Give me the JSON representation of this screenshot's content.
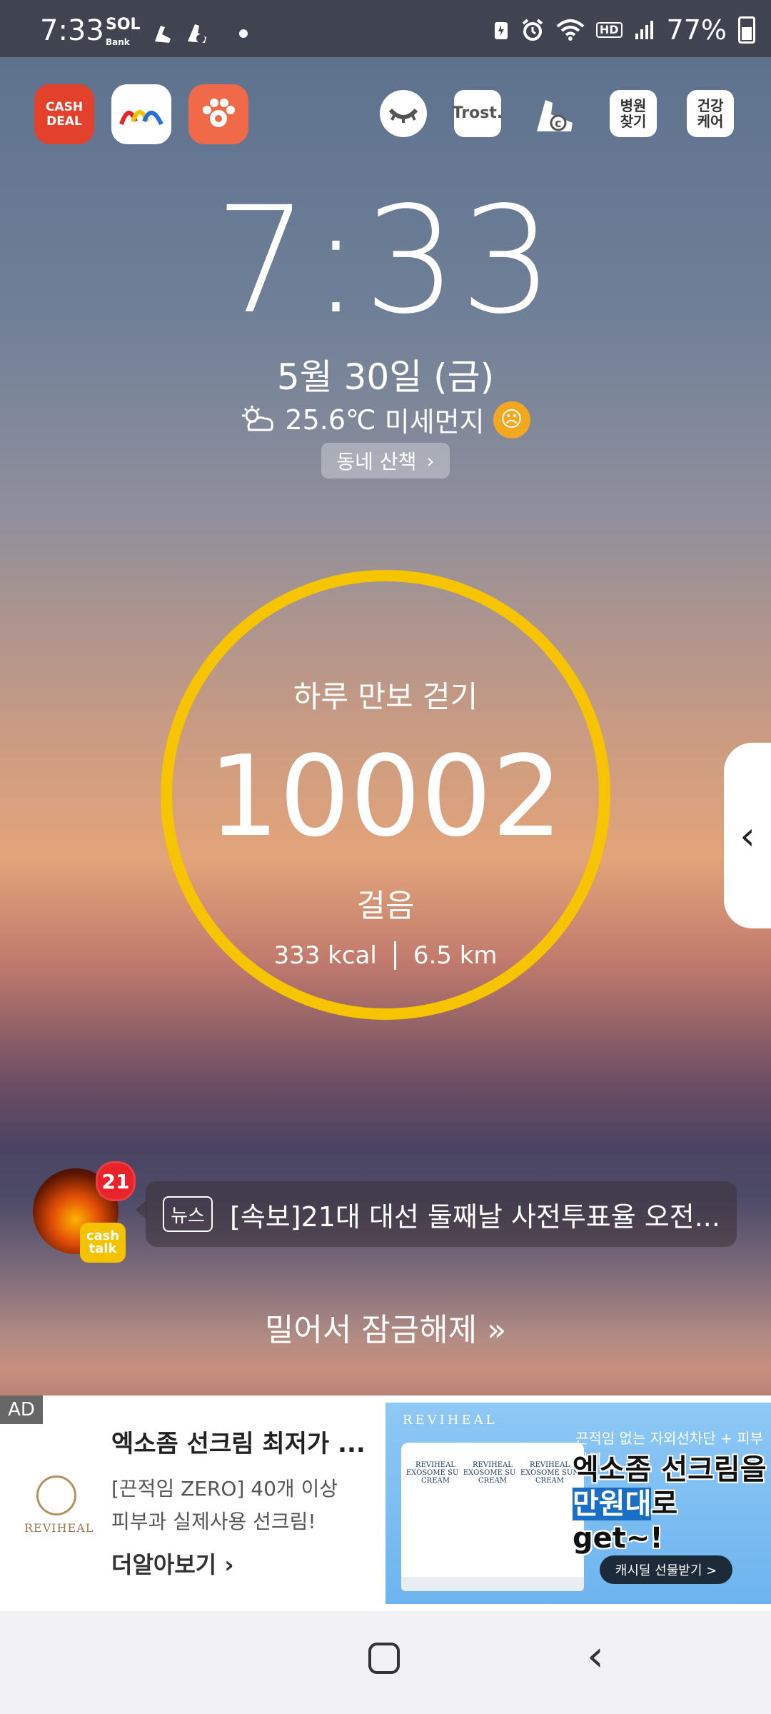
{
  "status_bar": {
    "time": "7:33",
    "left_icons": [
      "shinhan-sol-bank-icon",
      "shoe-icon",
      "cashwalk-icon"
    ],
    "sol_bank_label": "SOL",
    "sol_bank_sub": "Bank",
    "hd_voice": "HD",
    "battery": "77%"
  },
  "shortcuts": {
    "cash_deal": "CASH\nDEAL",
    "trost": "Trost.",
    "hospital": "병원\n찾기",
    "health": "건강\n케어"
  },
  "clock": {
    "time": "7:33",
    "date": "5월 30일 (금)",
    "temperature": "25.6℃",
    "dust_label": "미세먼지",
    "walk_button": "동네 산책"
  },
  "steps": {
    "title": "하루 만보 걷기",
    "count": "10002",
    "unit": "걸음",
    "kcal": "333 kcal",
    "distance": "6.5 km"
  },
  "news": {
    "badge_count": "21",
    "cashtalk_label": "cash\ntalk",
    "tag": "뉴스",
    "headline": "[속보]21대 대선 둘째날 사전투표율 오전..."
  },
  "unlock_text": "밀어서 잠금해제",
  "ad": {
    "tag": "AD",
    "brand": "REVIHEAL",
    "title": "엑소좀 선크림 최저가 ...",
    "desc_line1": "[끈적임 ZERO] 40개 이상",
    "desc_line2": "피부과 실제사용 선크림!",
    "more": "더알아보기",
    "image_brand": "REVIHEAL",
    "tube_text": "REVIHEAL EXOSOME SUN CREAM",
    "copy_top": "끈적임 없는 자외선차단 + 피부관리",
    "copy_line1": "엑소좀 선크림을",
    "copy_hl": "만원대",
    "copy_line2_rest": "로 get~!",
    "cta": "캐시딜 선물받기 >"
  },
  "colors": {
    "ring": "#f7c400",
    "badge": "#e8232a",
    "cash_deal": "#e3412b"
  }
}
